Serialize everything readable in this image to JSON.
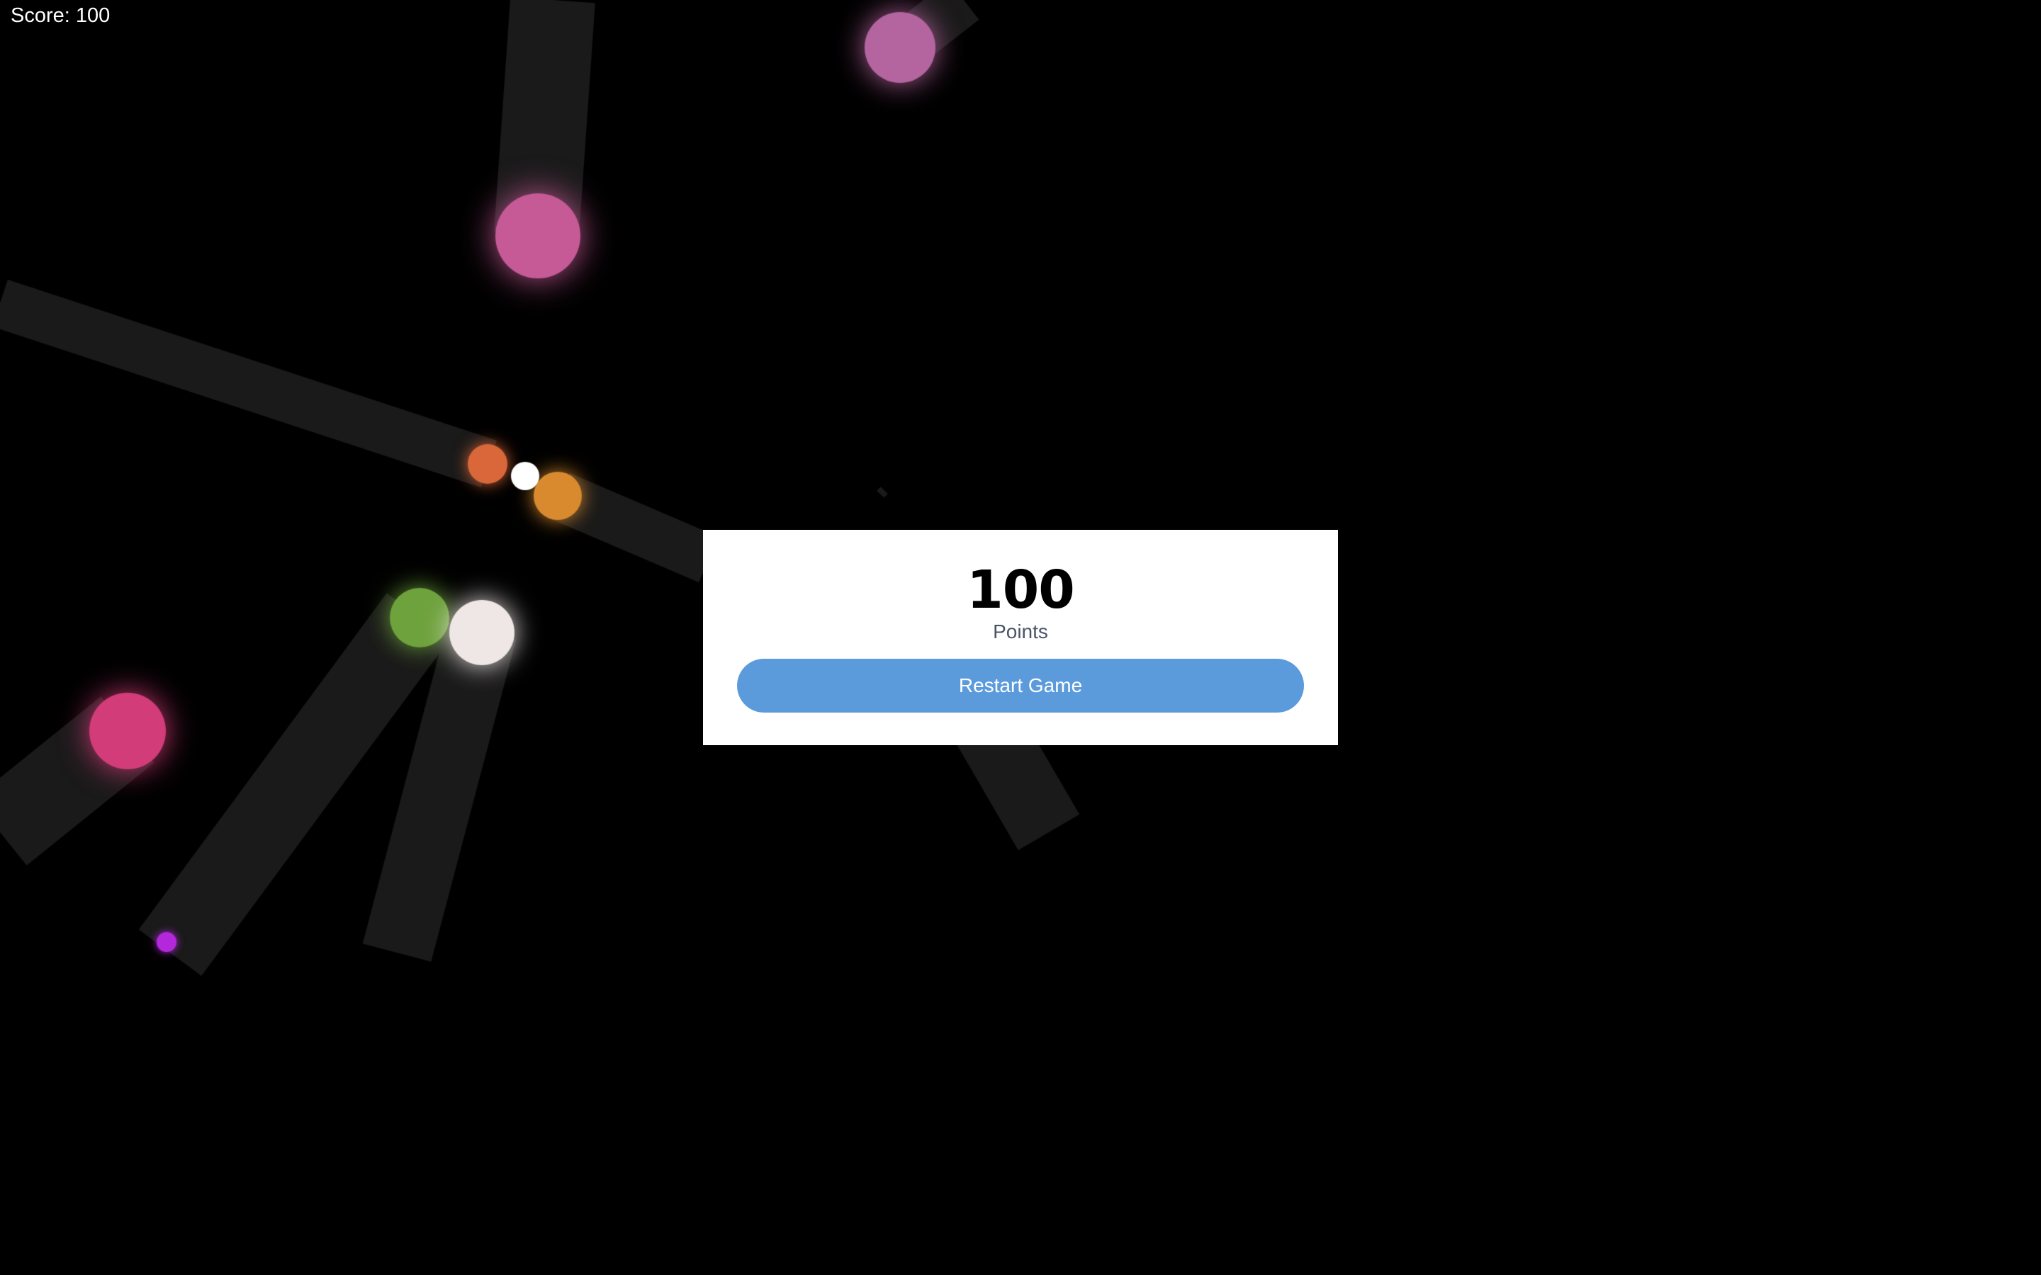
{
  "hud": {
    "score_text": "Score: 100"
  },
  "game_over": {
    "score": "100",
    "score_caption": "Points",
    "restart_label": "Restart Game"
  },
  "colors": {
    "background": "#000000",
    "modal_background": "#ffffff",
    "button": "#5b9bdc",
    "player": "#ffffff",
    "trail": "#1a1a1a"
  },
  "player": {
    "color": "#ffffff"
  },
  "enemies": [
    {
      "color": "#c55a96"
    },
    {
      "color": "#b4649e"
    },
    {
      "color": "#d9673a"
    },
    {
      "color": "#d98a2e"
    },
    {
      "color": "#6ea23c"
    },
    {
      "color": "#efe6e6"
    },
    {
      "color": "#d23c78"
    },
    {
      "color": "#b428dc"
    }
  ]
}
